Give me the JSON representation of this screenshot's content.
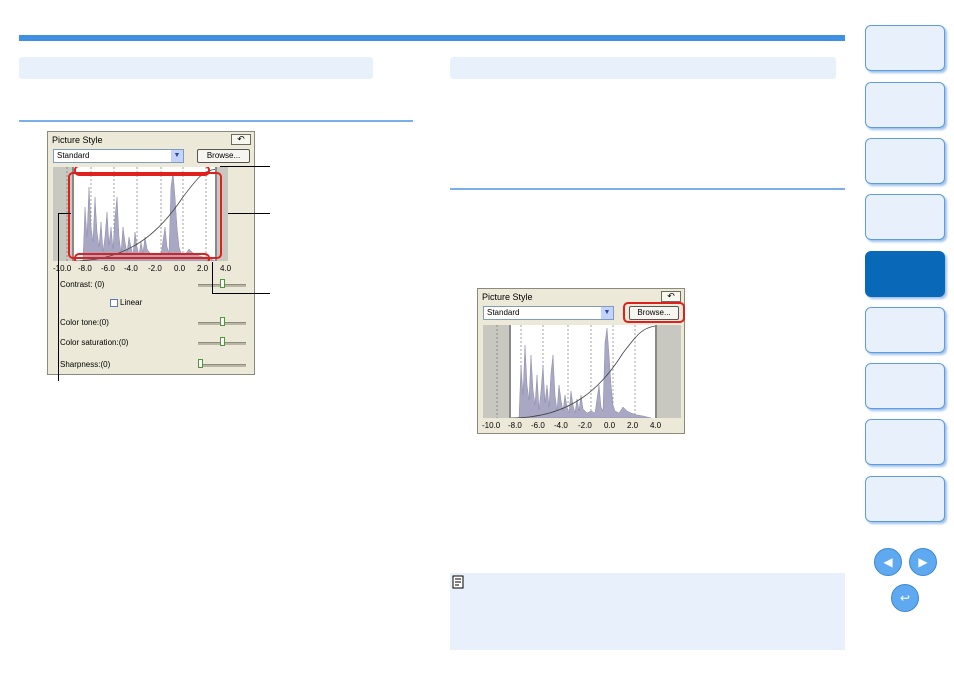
{
  "panel": {
    "title": "Picture Style",
    "undo_icon": "undo-icon",
    "style_value": "Standard",
    "browse_label": "Browse...",
    "ticks": [
      "-10.0",
      "-8.0",
      "-6.0",
      "-4.0",
      "-2.0",
      "0.0",
      "2.0",
      "4.0"
    ],
    "contrast_label": "Contrast: (0)",
    "linear_label": "Linear",
    "color_tone_label": "Color tone:(0)",
    "color_saturation_label": "Color saturation:(0)",
    "sharpness_label": "Sharpness:(0)"
  },
  "colors": {
    "accent": "#3f8fe3",
    "section_bg": "#e8f1fb",
    "nav_active": "#0a68b8",
    "highlight_red": "#e0201c",
    "histogram": "#a9a8c4"
  },
  "nav": {
    "prev_icon": "arrow-left-icon",
    "next_icon": "arrow-right-icon",
    "back_icon": "return-icon",
    "memo_icon": "memo-icon"
  }
}
